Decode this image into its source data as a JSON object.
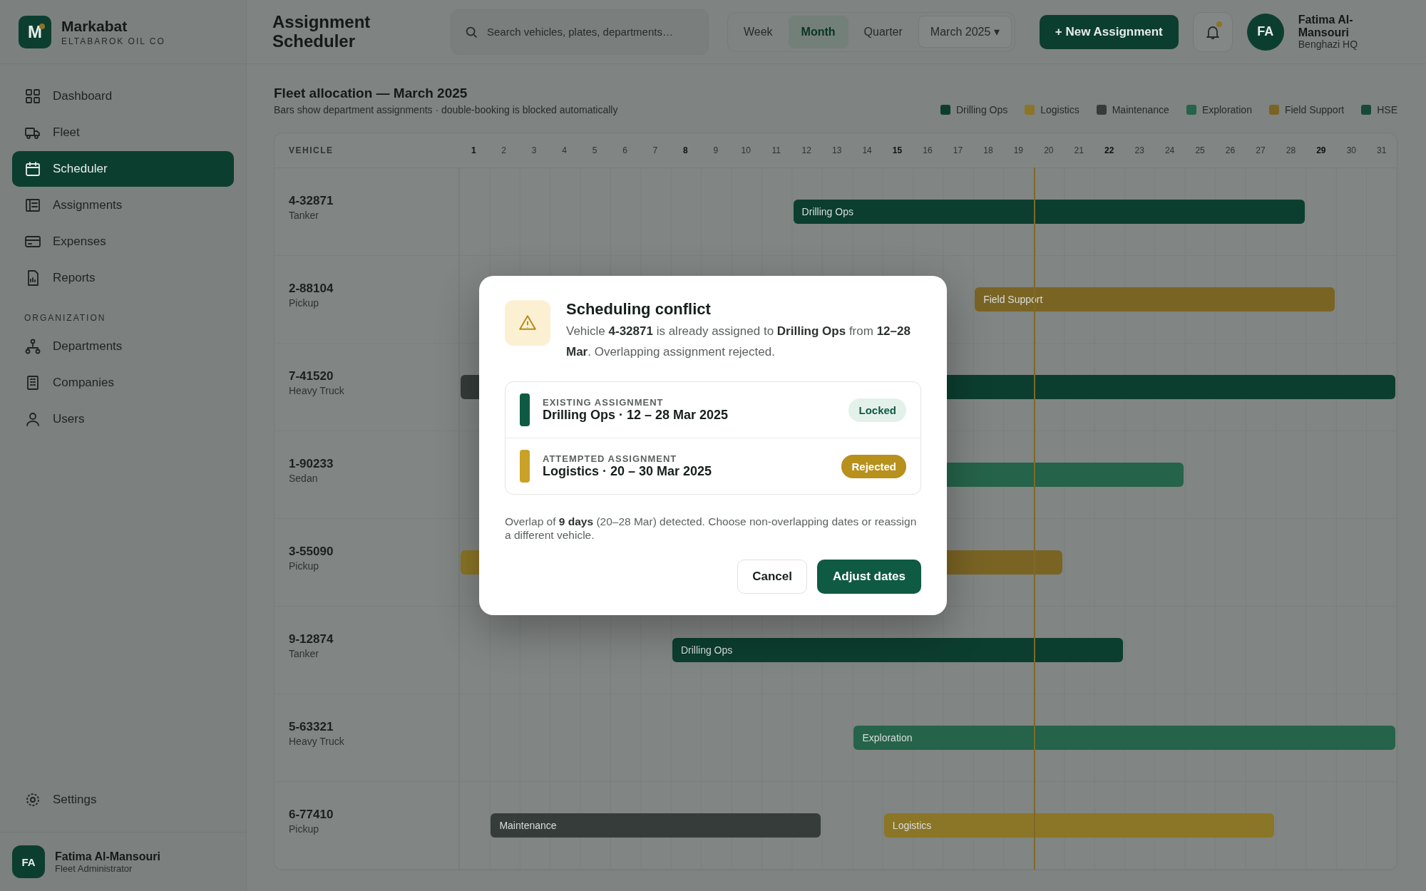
{
  "brand": {
    "logo": "M",
    "name": "Markabat",
    "subtitle": "ELTABAROK OIL CO"
  },
  "page_title": "Assignment Scheduler",
  "search": {
    "placeholder": "Search vehicles, plates, departments…"
  },
  "views": [
    {
      "label": "Week",
      "selected": false
    },
    {
      "label": "Month",
      "selected": true
    },
    {
      "label": "Quarter",
      "selected": false
    }
  ],
  "period": "March 2025 ▾",
  "new_button": "+ New Assignment",
  "user": {
    "initials": "FA",
    "name": "Fatima Al-Mansouri",
    "location": "Benghazi HQ"
  },
  "sidebar": {
    "items": [
      {
        "label": "Dashboard",
        "selected": false
      },
      {
        "label": "Fleet",
        "selected": false
      },
      {
        "label": "Scheduler",
        "selected": true
      },
      {
        "label": "Assignments",
        "selected": false
      },
      {
        "label": "Expenses",
        "selected": false
      },
      {
        "label": "Reports",
        "selected": false
      }
    ],
    "section": "ORGANIZATION",
    "org_items": [
      {
        "label": "Departments",
        "selected": false
      },
      {
        "label": "Companies",
        "selected": false
      },
      {
        "label": "Users",
        "selected": false
      }
    ],
    "settings": "Settings",
    "account": {
      "initials": "FA",
      "name": "Fatima Al-Mansouri",
      "role": "Fleet Administrator"
    }
  },
  "heading": "Fleet allocation — March 2025",
  "subheading": "Bars show department assignments · double-booking is blocked automatically",
  "legend": [
    {
      "label": "Drilling Ops",
      "color": "#0c3e2f"
    },
    {
      "label": "Logistics",
      "color": "#8b7526"
    },
    {
      "label": "Maintenance",
      "color": "#353c39"
    },
    {
      "label": "Exploration",
      "color": "#25634a"
    },
    {
      "label": "Field Support",
      "color": "#7a6424"
    },
    {
      "label": "HSE",
      "color": "#17493a"
    }
  ],
  "table": {
    "vehicle_header": "VEHICLE",
    "days": [
      {
        "label": "1",
        "week_start": true
      },
      {
        "label": "2",
        "week_start": false
      },
      {
        "label": "3",
        "week_start": false
      },
      {
        "label": "4",
        "week_start": false
      },
      {
        "label": "5",
        "week_start": false
      },
      {
        "label": "6",
        "week_start": false
      },
      {
        "label": "7",
        "week_start": false
      },
      {
        "label": "8",
        "week_start": true
      },
      {
        "label": "9",
        "week_start": false
      },
      {
        "label": "10",
        "week_start": false
      },
      {
        "label": "11",
        "week_start": false
      },
      {
        "label": "12",
        "week_start": false
      },
      {
        "label": "13",
        "week_start": false
      },
      {
        "label": "14",
        "week_start": false
      },
      {
        "label": "15",
        "week_start": true
      },
      {
        "label": "16",
        "week_start": false
      },
      {
        "label": "17",
        "week_start": false
      },
      {
        "label": "18",
        "week_start": false
      },
      {
        "label": "19",
        "week_start": false
      },
      {
        "label": "20",
        "week_start": false
      },
      {
        "label": "21",
        "week_start": false
      },
      {
        "label": "22",
        "week_start": true
      },
      {
        "label": "23",
        "week_start": false
      },
      {
        "label": "24",
        "week_start": false
      },
      {
        "label": "25",
        "week_start": false
      },
      {
        "label": "26",
        "week_start": false
      },
      {
        "label": "27",
        "week_start": false
      },
      {
        "label": "28",
        "week_start": false
      },
      {
        "label": "29",
        "week_start": true
      },
      {
        "label": "30",
        "week_start": false
      },
      {
        "label": "31",
        "week_start": false
      }
    ],
    "rows": [
      {
        "plate": "4-32871",
        "type": "Tanker",
        "bars": [
          {
            "label": "Drilling Ops",
            "color": "#0c3e2f"
          }
        ]
      },
      {
        "plate": "2-88104",
        "type": "Pickup",
        "bars": [
          {
            "label": "Field Support",
            "color": "#7a6424"
          }
        ]
      },
      {
        "plate": "7-41520",
        "type": "Heavy Truck",
        "bars": [
          {
            "color": "#353c39"
          },
          {
            "color": "#0c3e2f"
          }
        ]
      },
      {
        "plate": "1-90233",
        "type": "Sedan",
        "bars": [
          {
            "color": "#25634a"
          }
        ]
      },
      {
        "plate": "3-55090",
        "type": "Pickup",
        "bars": [
          {
            "color": "#8b7526"
          },
          {
            "color": "#7a6424"
          }
        ]
      },
      {
        "plate": "9-12874",
        "type": "Tanker",
        "bars": [
          {
            "label": "Drilling Ops",
            "color": "#0c3e2f"
          }
        ]
      },
      {
        "plate": "5-63321",
        "type": "Heavy Truck",
        "bars": [
          {
            "label": "Exploration",
            "color": "#25634a"
          }
        ]
      },
      {
        "plate": "6-77410",
        "type": "Pickup",
        "bars": [
          {
            "label": "Maintenance",
            "color": "#353c39"
          },
          {
            "label": "Logistics",
            "color": "#8b7526"
          }
        ]
      }
    ]
  },
  "dialog": {
    "title": "Scheduling conflict",
    "message": "Vehicle **4-32871** is already assigned to **Drilling Ops** from **12–28 Mar**. Overlapping assignment rejected.",
    "assignments": [
      {
        "caption": "EXISTING ASSIGNMENT",
        "detail": "Drilling Ops · 12 – 28 Mar 2025",
        "color": "#0f5a43",
        "status": "Locked",
        "kind": "locked"
      },
      {
        "caption": "ATTEMPTED ASSIGNMENT",
        "detail": "Logistics · 20 – 30 Mar 2025",
        "color": "#c9a227",
        "status": "Rejected",
        "kind": "rejected"
      }
    ],
    "note": "Overlap of **9 days** (20–28 Mar) detected. Choose non-overlapping dates or reassign a different vehicle.",
    "buttons": [
      {
        "label": "Cancel",
        "kind": "secondary"
      },
      {
        "label": "Adjust dates",
        "kind": "primary"
      }
    ]
  }
}
